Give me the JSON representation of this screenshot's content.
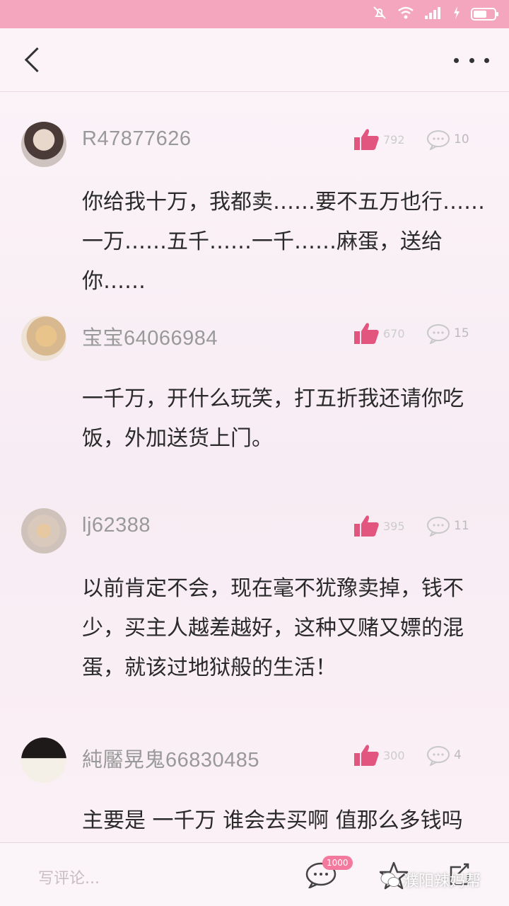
{
  "colors": {
    "status_bar": "#f3a6bd",
    "accent": "#e85b85",
    "badge": "#f37a9e"
  },
  "nav": {
    "back_icon": "chevron-left-icon",
    "more_icon": "more-dots-icon"
  },
  "comments": [
    {
      "username": "R47877626",
      "meta": "",
      "likes": "792",
      "replies": "10",
      "text": "你给我十万，我都卖……要不五万也行……一万……五千……一千……麻蛋，送给你……"
    },
    {
      "username": "宝宝64066984",
      "meta": "",
      "likes": "670",
      "replies": "15",
      "text": "一千万，开什么玩笑，打五折我还请你吃饭，外加送货上门。"
    },
    {
      "username": "lj62388",
      "meta": "",
      "likes": "395",
      "replies": "11",
      "text": "以前肯定不会，现在毫不犹豫卖掉，钱不少，买主人越差越好，这种又赌又嫖的混蛋，就该过地狱般的生活！"
    },
    {
      "username": "純靨晃鬼66830485",
      "meta": "",
      "likes": "300",
      "replies": "4",
      "text": "主要是 一千万 谁会去买啊 值那么多钱吗"
    }
  ],
  "bottom": {
    "input_placeholder": "写评论...",
    "badge": "1000",
    "watermark": "濮阳辣妈帮"
  }
}
